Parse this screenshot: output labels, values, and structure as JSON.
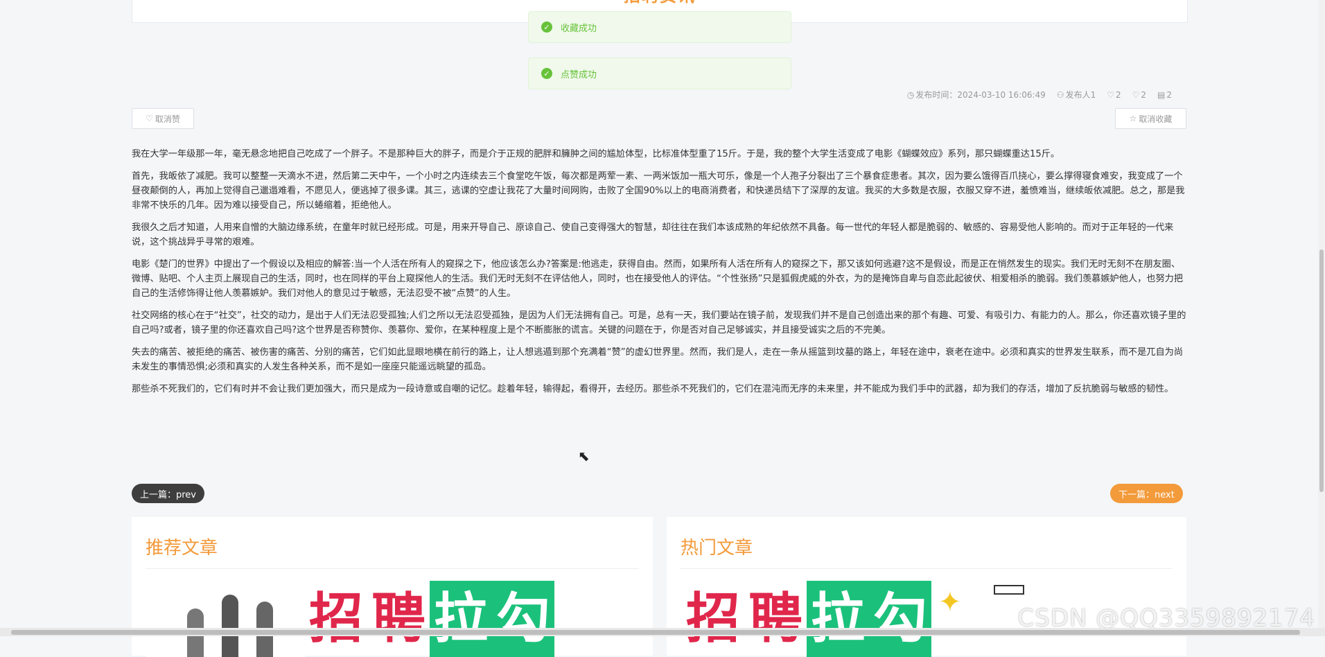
{
  "header": {
    "title": "招聘资讯"
  },
  "toasts": [
    "收藏成功",
    "点赞成功"
  ],
  "meta": {
    "publish_time": "发布时间：2024-03-10 16:06:49",
    "author": "发布人1",
    "likes": "2",
    "dislikes": "2",
    "comments": "2"
  },
  "actions": {
    "unlike": "取消赞",
    "uncollect": "取消收藏"
  },
  "article": {
    "paragraphs": [
      "我在大学一年级那一年，毫无悬念地把自己吃成了一个胖子。不是那种巨大的胖子，而是介于正规的肥胖和臃肿之间的尴尬体型，比标准体型重了15斤。于是，我的整个大学生活变成了电影《蝴蝶效应》系列，那只蝴蝶重达15斤。",
      "首先，我皈依了减肥。我可以整整一天滴水不进，然后第二天中午，一个小时之内连续去三个食堂吃午饭，每次都是两荤一素、一两米饭加一瓶大可乐，像是一个人孢子分裂出了三个暴食症患者。其次，因为要么饿得百爪挠心，要么撑得寝食难安，我变成了一个昼夜颠倒的人，再加上觉得自己邋遢难看，不愿见人，便逃掉了很多课。其三，逃课的空虚让我花了大量时间网购，击败了全国90%以上的电商消费者，和快递员结下了深厚的友谊。我买的大多数是衣服，衣服又穿不进，羞愤难当，继续皈依减肥。总之，那是我非常不快乐的几年。因为难以接受自己，所以蜷缩着，拒绝他人。",
      "我很久之后才知道，人用来自憎的大脑边缘系统，在童年时就已经形成。可是，用来开导自己、原谅自己、使自己变得强大的智慧，却往往在我们本该成熟的年纪依然不具备。每一世代的年轻人都是脆弱的、敏感的、容易受他人影响的。而对于正年轻的一代来说，这个挑战异乎寻常的艰难。",
      "电影《楚门的世界》中提出了一个假设以及相应的解答:当一个人活在所有人的窥探之下，他应该怎么办?答案是:他逃走，获得自由。然而，如果所有人活在所有人的窥探之下，那又该如何逃避?这不是假设，而是正在悄然发生的现实。我们无时无刻不在朋友圈、微博、贴吧、个人主页上展现自己的生活，同时，也在同样的平台上窥探他人的生活。我们无时无刻不在评估他人，同时，也在接受他人的评估。“个性张扬”只是狐假虎威的外衣，为的是掩饰自卑与自恋此起彼伏、相爱相杀的脆弱。我们羡慕嫉妒他人，也努力把自己的生活修饰得让他人羡慕嫉妒。我们对他人的意见过于敏感，无法忍受不被“点赞”的人生。",
      "社交网络的核心在于“社交”，社交的动力，是出于人们无法忍受孤独;人们之所以无法忍受孤独，是因为人们无法拥有自己。可是，总有一天，我们要站在镜子前，发现我们并不是自己创造出来的那个有趣、可爱、有吸引力、有能力的人。那么，你还喜欢镜子里的自己吗?或者，镜子里的你还喜欢自己吗?这个世界是否称赞你、羡慕你、爱你，在某种程度上是个不断膨胀的谎言。关键的问题在于，你是否对自己足够诚实，并且接受诚实之后的不完美。",
      "失去的痛苦、被拒绝的痛苦、被伤害的痛苦、分别的痛苦，它们如此显眼地横在前行的路上，让人想逃遁到那个充满着“赞”的虚幻世界里。然而，我们是人，走在一条从摇篮到坟墓的路上，年轻在途中，衰老在途中。必须和真实的世界发生联系，而不是兀自为尚未发生的事情恐惧;必须和真实的人发生各种关系，而不是如一座座只能遥远眺望的孤岛。",
      "那些杀不死我们的，它们有时并不会让我们更加强大，而只是成为一段诗意或自嘲的记忆。趁着年轻，输得起，看得开，去经历。那些杀不死我们的，它们在混沌而无序的未来里，并不能成为我们手中的武器，却为我们的存活，增加了反抗脆弱与敏感的韧性。"
    ]
  },
  "nav": {
    "prev": "上一篇：prev",
    "next": "下一篇：next"
  },
  "panels": {
    "recommended": "推荐文章",
    "hot": "热门文章"
  },
  "banner": {
    "chars": [
      "招",
      "聘",
      "拉",
      "勾"
    ]
  },
  "watermark": "CSDN @QQ3359892174",
  "colors": {
    "accent": "#f39a3a",
    "success": "#67c23a",
    "dark_pill": "#3e3e3e",
    "banner_red": "#e0274b",
    "banner_green": "#1bc17b"
  }
}
